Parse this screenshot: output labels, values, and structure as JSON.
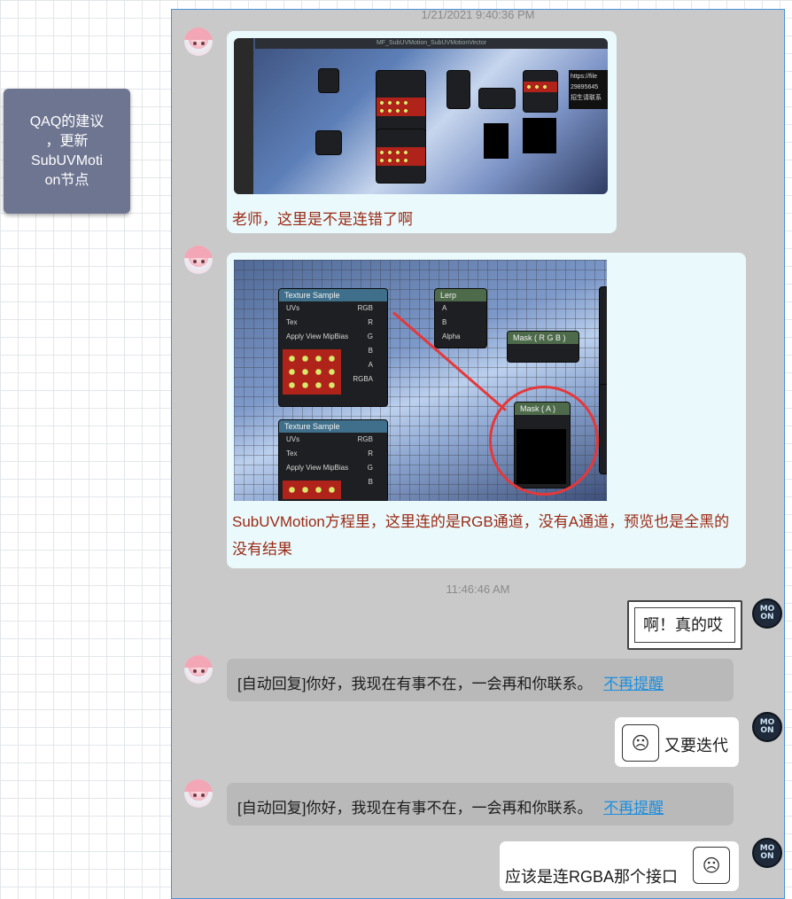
{
  "note": {
    "text": "QAQ的建议\n，更新\nSubUVMoti\non节点"
  },
  "timestamps": {
    "first": "1/21/2021 9:40:36 PM",
    "second": "11:46:46 AM"
  },
  "screenshot1": {
    "title": "MF_SubUVMotion_SubUVMotionVector",
    "panel_lines": [
      "https://file",
      "29895645",
      "招生请联系"
    ]
  },
  "screenshot2": {
    "texture_sample_1": {
      "title": "Texture Sample",
      "inputs": [
        "UVs",
        "Tex",
        "Apply View MipBias"
      ],
      "outputs": [
        "RGB",
        "R",
        "G",
        "B",
        "A",
        "RGBA"
      ]
    },
    "texture_sample_2": {
      "title": "Texture Sample",
      "inputs": [
        "UVs",
        "Tex",
        "Apply View MipBias"
      ],
      "outputs": [
        "RGB",
        "R",
        "G",
        "B"
      ]
    },
    "lerp": {
      "title": "Lerp",
      "inputs": [
        "A",
        "B",
        "Alpha"
      ]
    },
    "mask_rgb": {
      "title": "Mask ( R G B )"
    },
    "mask_a": {
      "title": "Mask ( A )"
    }
  },
  "messages": {
    "m1_text": "老师，这里是不是连错了啊",
    "m2_text": "SubUVMotion方程里，这里连的是RGB通道，没有A通道，预览也是全黑的没有结果",
    "m3_text": "啊！真的哎",
    "m4_text": "[自动回复]你好，我现在有事不在，一会再和你联系。",
    "m4_link": "不再提醒",
    "m5_text": "又要迭代",
    "m6_text": "[自动回复]你好，我现在有事不在，一会再和你联系。",
    "m6_link": "不再提醒",
    "m7_text": "应该是连RGBA那个接口"
  },
  "avatar_me": {
    "label": "MO\nON"
  },
  "colors": {
    "note_bg": "#6e7591",
    "chat_bg": "#c9c9c9",
    "bubble_light": "#eaf9fb",
    "red_text": "#9a2a16",
    "link": "#1a8fe0",
    "annotation_red": "#e5383b"
  }
}
